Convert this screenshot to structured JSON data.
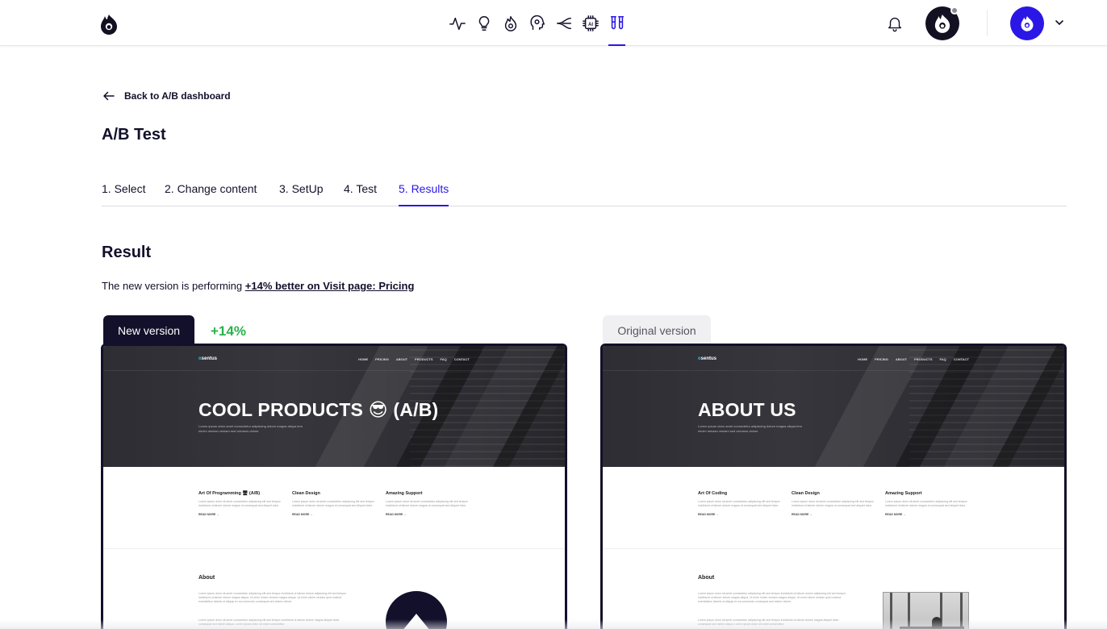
{
  "header": {
    "nav_icons": [
      "pulse-icon",
      "lightbulb-icon",
      "flame-icon",
      "head-icon",
      "funnel-icon",
      "ai-chip-icon",
      "test-tubes-icon"
    ],
    "active_nav": "test-tubes-icon",
    "brand_color": "#2a17e6"
  },
  "back_link": "Back to A/B dashboard",
  "page_title": "A/B Test",
  "tabs": [
    {
      "label": "1. Select"
    },
    {
      "label": "2. Change content"
    },
    {
      "label": "3. SetUp"
    },
    {
      "label": "4. Test"
    },
    {
      "label": "5. Results"
    }
  ],
  "active_tab": "5. Results",
  "result": {
    "title": "Result",
    "sentence_prefix": "The new version is performing",
    "sentence_link": "+14% better on Visit page: Pricing"
  },
  "new_version": {
    "tag": "New version",
    "delta": "+14%",
    "delta_color": "#2bb24a",
    "preview": {
      "brand_accent": "o",
      "brand_rest": "sentus",
      "nav": [
        "HOME",
        "PRICING",
        "ABOUT",
        "PRODUCTS",
        "FAQ",
        "CONTACT"
      ],
      "hero_title": "COOL PRODUCTS 😎 (A/B)",
      "hero_sub": "Lorem ipsum dolor amet consectetur adipiscing dolore magna aliqua tem minim neiulan veniam sed veiumus dolore",
      "features": [
        {
          "title": "Art Of Programming 🖥 (A/B)",
          "desc": "Lorem ipsum dolor sit amet consectetur adipiscing elit sed tempor incididunt ut labore dolore magna ut consequat sed aliquet dolor",
          "more": "READ MORE →"
        },
        {
          "title": "Clean Design",
          "desc": "Lorem ipsum dolor sit amet consectetur adipiscing elit sed tempor incididunt ut labore dolore magna ut consequat sed aliquet dolor",
          "more": "READ MORE →"
        },
        {
          "title": "Amazing Support",
          "desc": "Lorem ipsum dolor sit amet consectetur adipiscing elit sed tempor incididunt ut labore dolore magna ut consequat sed aliquet dolor",
          "more": "READ MORE →"
        }
      ],
      "about_title": "About",
      "about_text": "Lorem ipsum dolor sit amet consectetur adipiscing elit sed tempor incididunt ut labore dolore adipiscing elit sed tempor incididunt ut labore dolore magna aliqua. Ut enim minim veniam magna aliqua. Ut enim minim veniam quis nostrud exercitation laboris ut aliquip ex ea commodo consequat sed dolore dolore.",
      "about_text2": "Lorem ipsum dolor sit amet consectetur adipiscing elit sed tempor incididunt ut labore dolore magna aliquet dolor consequat sed minim aliqua. Lorem ipsum dolor sit amet consectetur"
    }
  },
  "original_version": {
    "tag": "Original version",
    "preview": {
      "brand_accent": "o",
      "brand_rest": "sentus",
      "nav": [
        "HOME",
        "PRICING",
        "ABOUT",
        "PRODUCTS",
        "FAQ",
        "CONTACT"
      ],
      "hero_title": "ABOUT US",
      "hero_sub": "Lorem ipsum dolor amet consectetur adipiscing dolore magna aliqua tem minim neiulan veniam sed veiumus dolore",
      "features": [
        {
          "title": "Art Of Coding",
          "desc": "Lorem ipsum dolor sit amet consectetur adipiscing elit sed tempor incididunt ut labore dolore magna ut consequat sed aliquet dolor",
          "more": "READ MORE →"
        },
        {
          "title": "Clean Design",
          "desc": "Lorem ipsum dolor sit amet consectetur adipiscing elit sed tempor incididunt ut labore dolore magna ut consequat sed aliquet dolor",
          "more": "READ MORE →"
        },
        {
          "title": "Amazing Support",
          "desc": "Lorem ipsum dolor sit amet consectetur adipiscing elit sed tempor incididunt ut labore dolore magna ut consequat sed aliquet dolor",
          "more": "READ MORE →"
        }
      ],
      "about_title": "About",
      "about_text": "Lorem ipsum dolor sit amet consectetur adipiscing elit sed tempor incididunt ut labore dolore adipiscing elit sed tempor incididunt ut labore dolore magna aliqua. Ut enim minim veniam magna aliqua. Ut enim minim veniam quis nostrud exercitation laboris ut aliquip ex ea commodo consequat sed dolore dolore.",
      "about_text2": "Lorem ipsum dolor sit amet consectetur adipiscing elit sed tempor incididunt ut labore dolore magna aliquet dolor consequat sed minim aliqua. Lorem ipsum dolor sit amet consectetur"
    }
  }
}
